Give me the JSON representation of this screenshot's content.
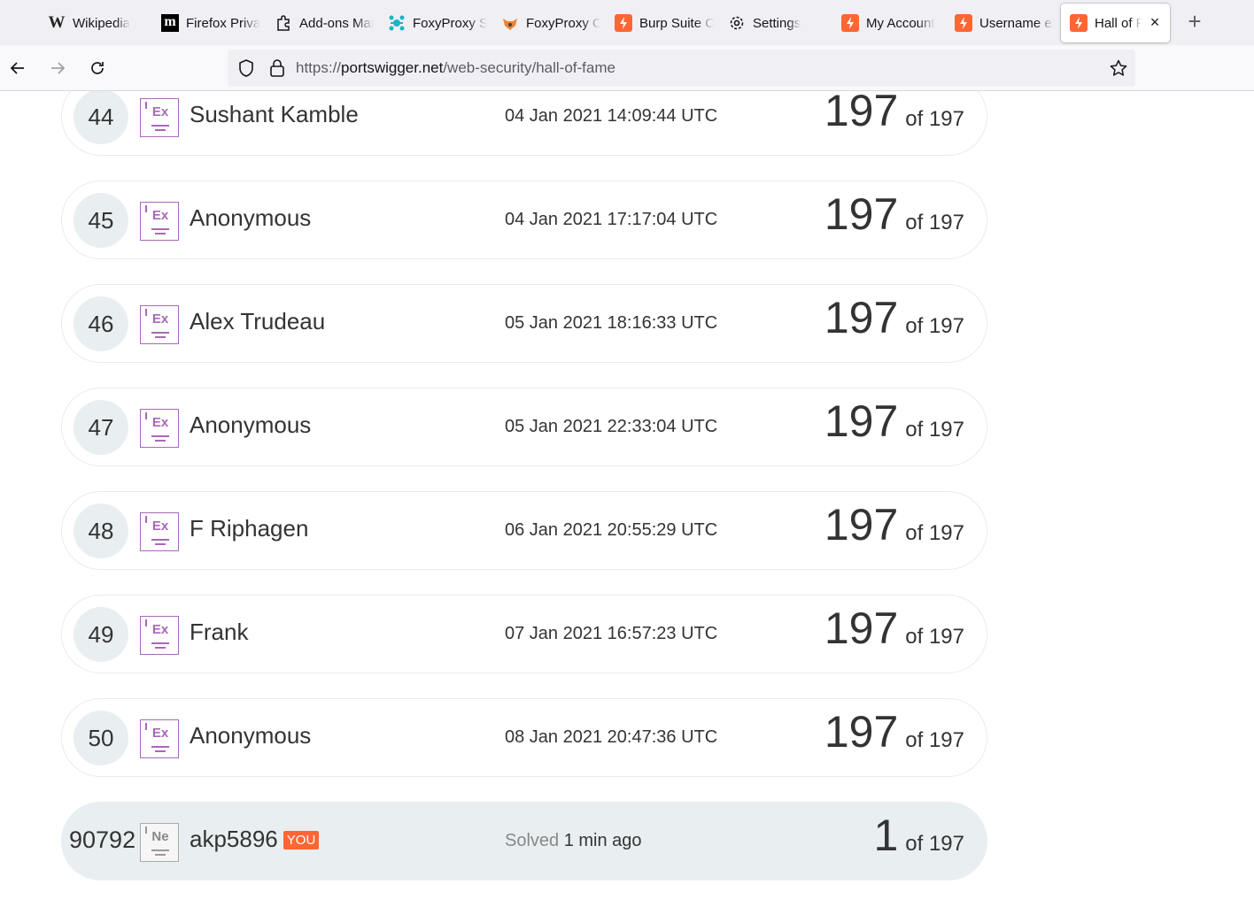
{
  "browser": {
    "tabs": [
      {
        "title": "Wikipedia",
        "icon": "wikipedia-icon"
      },
      {
        "title": "Firefox Privacy",
        "icon": "mozilla-m-icon"
      },
      {
        "title": "Add-ons Manager",
        "icon": "puzzle-icon"
      },
      {
        "title": "FoxyProxy Standard",
        "icon": "foxyproxy-icon"
      },
      {
        "title": "FoxyProxy Options",
        "icon": "fox-icon"
      },
      {
        "title": "Burp Suite Community",
        "icon": "burp-icon"
      },
      {
        "title": "Settings",
        "icon": "gear-icon"
      },
      {
        "title": "My Account",
        "icon": "burp-icon"
      },
      {
        "title": "Username enumeration",
        "icon": "burp-icon"
      },
      {
        "title": "Hall of Fame",
        "icon": "burp-icon",
        "active": true
      }
    ],
    "url_scheme": "https://",
    "url_host": "portswigger.net",
    "url_path": "/web-security/hall-of-fame"
  },
  "leaderboard": {
    "rows": [
      {
        "rank": "44",
        "level": "Ex",
        "name": "Sushant Kamble",
        "date": "04 Jan 2021 14:09:44 UTC",
        "solved": "197",
        "of": "of 197"
      },
      {
        "rank": "45",
        "level": "Ex",
        "name": "Anonymous",
        "date": "04 Jan 2021 17:17:04 UTC",
        "solved": "197",
        "of": "of 197"
      },
      {
        "rank": "46",
        "level": "Ex",
        "name": "Alex Trudeau",
        "date": "05 Jan 2021 18:16:33 UTC",
        "solved": "197",
        "of": "of 197"
      },
      {
        "rank": "47",
        "level": "Ex",
        "name": "Anonymous",
        "date": "05 Jan 2021 22:33:04 UTC",
        "solved": "197",
        "of": "of 197"
      },
      {
        "rank": "48",
        "level": "Ex",
        "name": "F Riphagen",
        "date": "06 Jan 2021 20:55:29 UTC",
        "solved": "197",
        "of": "of 197"
      },
      {
        "rank": "49",
        "level": "Ex",
        "name": "Frank",
        "date": "07 Jan 2021 16:57:23 UTC",
        "solved": "197",
        "of": "of 197"
      },
      {
        "rank": "50",
        "level": "Ex",
        "name": "Anonymous",
        "date": "08 Jan 2021 20:47:36 UTC",
        "solved": "197",
        "of": "of 197"
      }
    ],
    "you": {
      "rank": "90792",
      "level": "Ne",
      "name": "akp5896",
      "tag": "YOU",
      "solved_label": "Solved",
      "solved_ago": "1 min ago",
      "solved": "1",
      "of": "of 197"
    }
  },
  "colors": {
    "expert_badge": "#a968b8",
    "rank_circle": "#e9eef1",
    "you_tag": "#ff6633",
    "burp_orange": "#ff6633"
  }
}
